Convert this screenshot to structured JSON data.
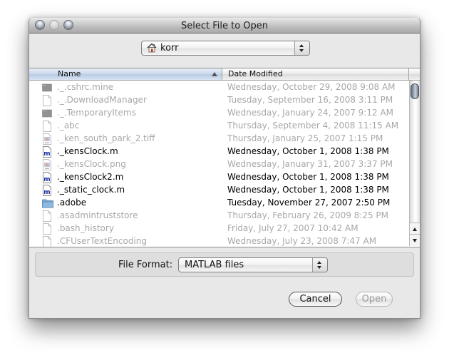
{
  "window": {
    "title": "Select File to Open",
    "controls": [
      "close",
      "minimize",
      "zoom"
    ]
  },
  "location": {
    "icon": "home-icon",
    "value": "korr"
  },
  "columns": {
    "name": "Name",
    "date": "Date Modified",
    "sorted_by": "Name",
    "sort_direction": "ascending"
  },
  "files": [
    {
      "name": "._.cshrc.mine",
      "date": "Wednesday, October 29, 2008 9:08 AM",
      "icon": "dark-folder-icon",
      "enabled": false
    },
    {
      "name": "._.DownloadManager",
      "date": "Tuesday, September 16, 2008 3:11 PM",
      "icon": "document-icon",
      "enabled": false
    },
    {
      "name": "._.TemporaryItems",
      "date": "Wednesday, January 24, 2007 9:12 AM",
      "icon": "dark-folder-icon",
      "enabled": false
    },
    {
      "name": "._abc",
      "date": "Thursday, September 4, 2008 11:15 AM",
      "icon": "document-icon",
      "enabled": false
    },
    {
      "name": "._ken_south_park_2.tiff",
      "date": "Thursday, January 25, 2007 1:15 PM",
      "icon": "image-file-icon",
      "enabled": false
    },
    {
      "name": "._kensClock.m",
      "date": "Wednesday, October 1, 2008 1:38 PM",
      "icon": "matlab-file-icon",
      "enabled": true
    },
    {
      "name": "._kensClock.png",
      "date": "Wednesday, January 31, 2007 3:37 PM",
      "icon": "image-file-icon",
      "enabled": false
    },
    {
      "name": "._kensClock2.m",
      "date": "Wednesday, October 1, 2008 1:38 PM",
      "icon": "matlab-file-icon",
      "enabled": true
    },
    {
      "name": "._static_clock.m",
      "date": "Wednesday, October 1, 2008 1:38 PM",
      "icon": "matlab-file-icon",
      "enabled": true
    },
    {
      "name": ".adobe",
      "date": "Tuesday, November 27, 2007 2:50 PM",
      "icon": "folder-icon",
      "enabled": true
    },
    {
      "name": ".asadmintruststore",
      "date": "Thursday, February 26, 2009 8:25 PM",
      "icon": "document-icon",
      "enabled": false
    },
    {
      "name": ".bash_history",
      "date": "Friday, July 27, 2007 10:42 AM",
      "icon": "document-icon",
      "enabled": false
    },
    {
      "name": ".CFUserTextEncoding",
      "date": "Wednesday, July 23, 2008 7:47 AM",
      "icon": "document-icon",
      "enabled": false
    }
  ],
  "format": {
    "label": "File Format:",
    "value": "MATLAB files"
  },
  "buttons": {
    "cancel": "Cancel",
    "open": "Open",
    "open_enabled": false
  },
  "colors": {
    "enabled_text": "#000000",
    "disabled_text": "#a8a8a8",
    "matlab_icon": "#1a2fa0",
    "folder_icon": "#7fb0d8"
  }
}
